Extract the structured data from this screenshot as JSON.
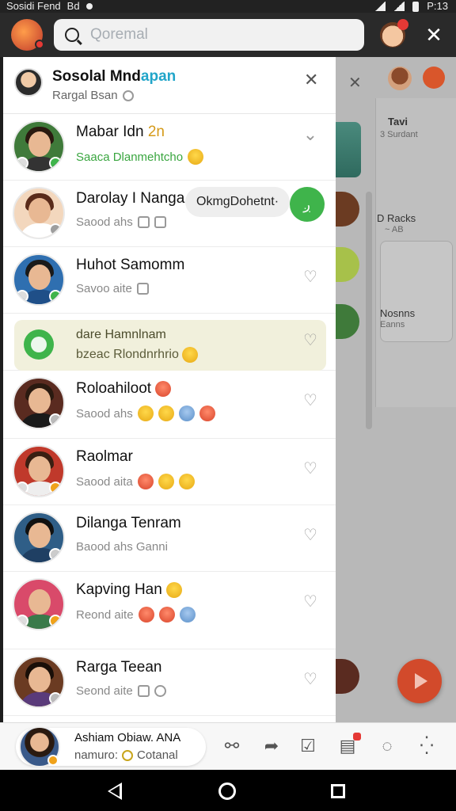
{
  "status_bar": {
    "left_text": "Sosidi Fend",
    "left_text2": "Bd",
    "time": "P:13"
  },
  "search": {
    "placeholder": "Qoremal"
  },
  "panel": {
    "title_main": "Sosolal Mnd",
    "title_accent": "apan",
    "subtitle": "Rargal Bsan"
  },
  "contacts": [
    {
      "name": "Mabar Idn",
      "name_highlight": "2n",
      "meta": "Saaca Dlanmehtcho",
      "meta_green": true,
      "avatar_color": "#3f7a3a",
      "status_color": "#3fb44b"
    },
    {
      "name": "Darolay I Nanga",
      "meta": "Saood ahs",
      "pill": "OkmgDohetnt·",
      "bubble": "ږ",
      "avatar_color": "#8b4a2b",
      "status_color": "#9e9e9e"
    },
    {
      "name": "Huhot Samomm",
      "meta": "Savoo aite",
      "avatar_color": "#2f6fb0",
      "status_color": "#3fb44b"
    },
    {
      "name": "Roloahiloot",
      "meta": "Saood ahs",
      "avatar_color": "#5a2b20",
      "status_color": "#bbbbbb"
    },
    {
      "name": "Raolmar",
      "meta": "Saood aita",
      "avatar_color": "#c0392b",
      "status_color": "#f0a21a"
    },
    {
      "name": "Dilanga Tenram",
      "meta": "Baood ahs  Ganni",
      "avatar_color": "#2f5e87",
      "status_color": "#cccccc"
    },
    {
      "name": "Kapving Han",
      "meta": "Reond aite",
      "avatar_color": "#d94a6a",
      "status_color": "#f0a21a"
    },
    {
      "name": "Rarga Teean",
      "meta": "Seond aite",
      "avatar_color": "#6b3b22",
      "status_color": "#bbbbbb"
    }
  ],
  "highlighted": {
    "line1": "dare Hamnlnam",
    "line2": "bzeac Rlondnrhrio"
  },
  "right_pane": {
    "t1": "Tavi",
    "t2": "3 Surdant",
    "t3": "D Racks",
    "t4": "~ AB",
    "t5": "Nosnns",
    "t6": "Eanns"
  },
  "bottom_card": {
    "line1": "Ashiam Obiaw. ANA",
    "line2_a": "namuro:",
    "line2_b": "Cotanal"
  },
  "icons": {
    "search": "search-icon",
    "close": "close-icon",
    "heart": "heart-icon",
    "chevron": "chevron-down-icon"
  },
  "colors": {
    "accent": "#21a5c9",
    "green": "#3fb44b",
    "highlight_bg": "#f1f0dc",
    "fab": "#d24a2b"
  }
}
